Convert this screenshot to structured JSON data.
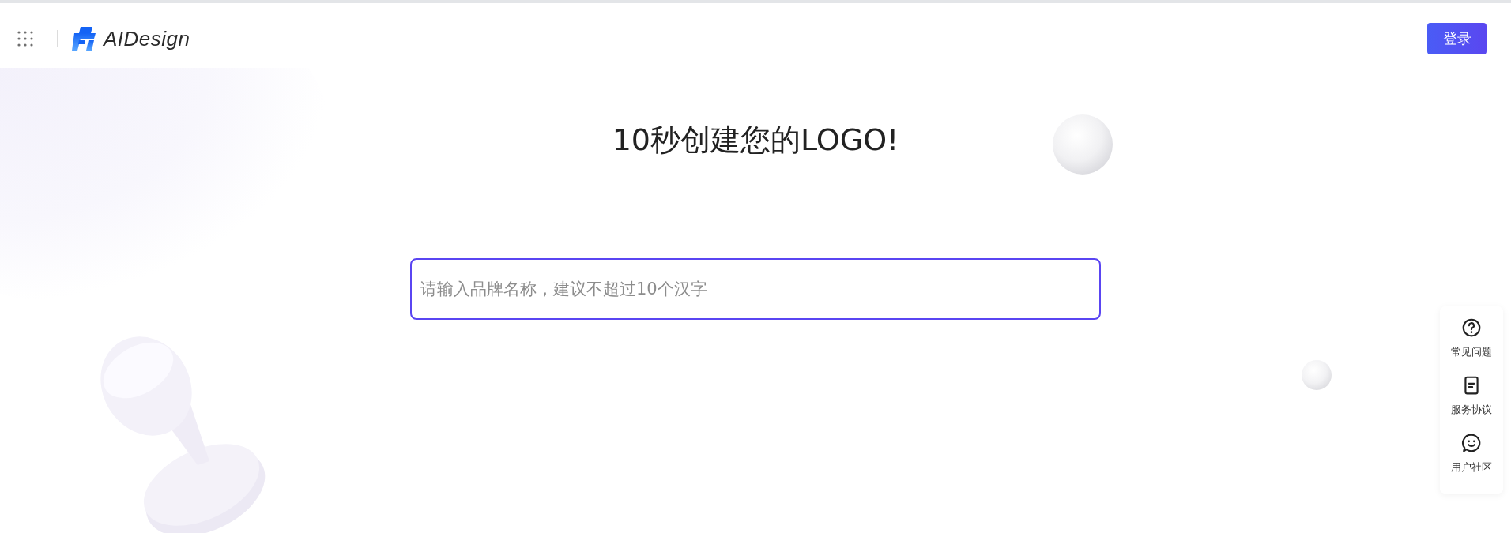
{
  "header": {
    "brand": "AIDesign",
    "login_button": "登录"
  },
  "hero": {
    "title": "10秒创建您的LOGO!"
  },
  "brand_input": {
    "placeholder": "请输入品牌名称，建议不超过10个汉字"
  },
  "side_panel": {
    "items": [
      {
        "kind": "faq",
        "label": "常见问题"
      },
      {
        "kind": "agreement",
        "label": "服务协议"
      },
      {
        "kind": "community",
        "label": "用户社区"
      }
    ]
  }
}
